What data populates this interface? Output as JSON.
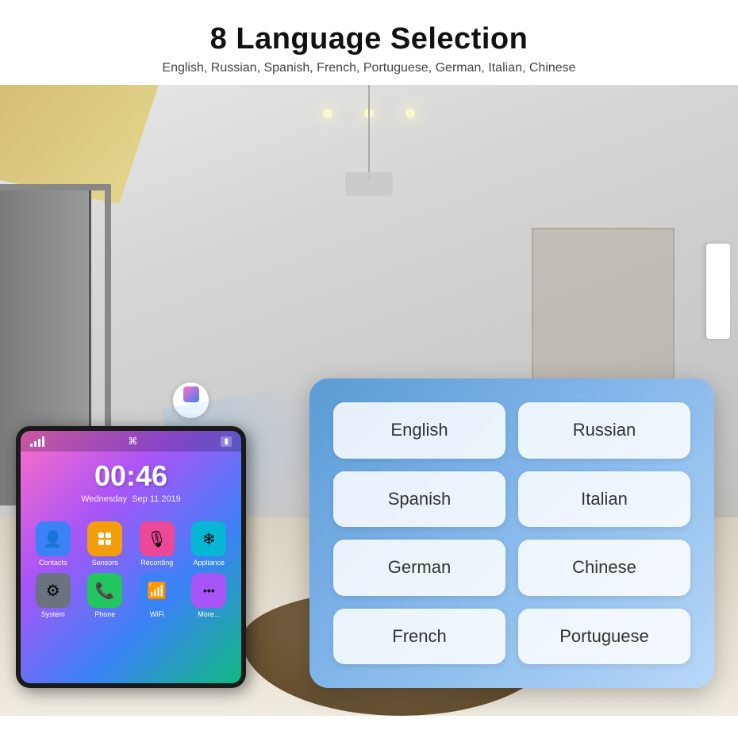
{
  "header": {
    "title": "8 Language Selection",
    "subtitle": "English, Russian, Spanish, French, Portuguese, German, Italian, Chinese"
  },
  "phone": {
    "time": "00:46",
    "day": "Wednesday",
    "date": "Sep 11 2019",
    "apps": [
      {
        "label": "Contacts",
        "color": "#3b82f6",
        "icon": "👤"
      },
      {
        "label": "Sensors",
        "color": "#f59e0b",
        "icon": "⚙"
      },
      {
        "label": "Recording",
        "color": "#ec4899",
        "icon": "🎙"
      },
      {
        "label": "Appliance",
        "color": "#06b6d4",
        "icon": "❄"
      },
      {
        "label": "System",
        "color": "#6b7280",
        "icon": "⚙"
      },
      {
        "label": "Phone",
        "color": "#22c55e",
        "icon": "📞"
      },
      {
        "label": "WiFi",
        "color": "#3b82f6",
        "icon": "📶"
      },
      {
        "label": "More...",
        "color": "#a855f7",
        "icon": "•••"
      }
    ]
  },
  "languages": {
    "buttons": [
      "English",
      "Russian",
      "Spanish",
      "Italian",
      "German",
      "Chinese",
      "French",
      "Portuguese"
    ]
  }
}
